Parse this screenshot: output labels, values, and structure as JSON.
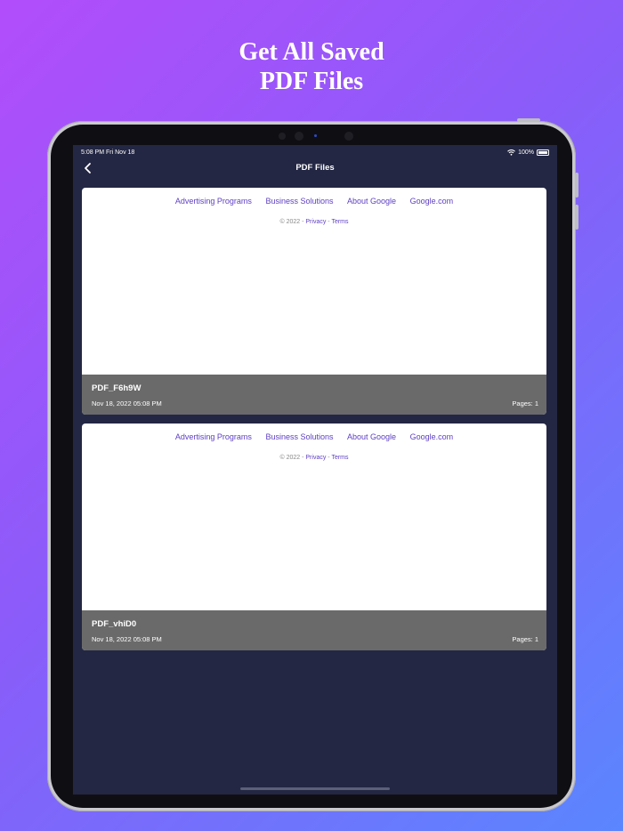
{
  "headline": {
    "line1": "Get All Saved",
    "line2": "PDF Files"
  },
  "status_bar": {
    "time_date": "5:08 PM   Fri Nov 18",
    "battery_percent": "100%"
  },
  "nav": {
    "title": "PDF Files",
    "back_icon": "chevron-left-icon"
  },
  "files": [
    {
      "preview": {
        "links": [
          "Advertising Programs",
          "Business Solutions",
          "About Google",
          "Google.com"
        ],
        "footer_prefix": "© 2022 - ",
        "footer_privacy": "Privacy",
        "footer_sep": " - ",
        "footer_terms": "Terms"
      },
      "name": "PDF_F6h9W",
      "date": "Nov 18, 2022 05:08 PM",
      "pages": "Pages: 1"
    },
    {
      "preview": {
        "links": [
          "Advertising Programs",
          "Business Solutions",
          "About Google",
          "Google.com"
        ],
        "footer_prefix": "© 2022 - ",
        "footer_privacy": "Privacy",
        "footer_sep": " - ",
        "footer_terms": "Terms"
      },
      "name": "PDF_vhiD0",
      "date": "Nov 18, 2022 05:08 PM",
      "pages": "Pages: 1"
    }
  ],
  "colors": {
    "screen_bg": "#232743",
    "info_bar": "#6a6a6a",
    "link_purple": "#5d3fc4",
    "gradient_start": "#b24dfb",
    "gradient_end": "#5a86ff"
  }
}
